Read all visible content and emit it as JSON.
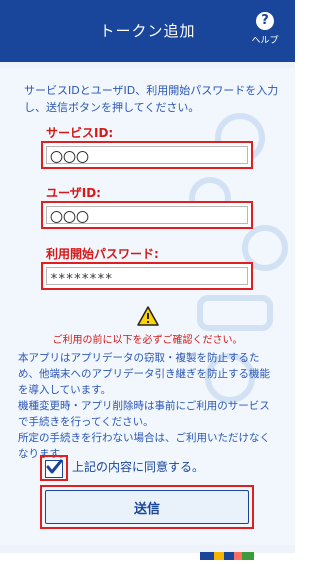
{
  "header": {
    "title": "トークン追加",
    "help_label": "ヘルプ"
  },
  "intro_text": "サービスIDとユーザID、利用開始パスワードを入力し、送信ボタンを押してください。",
  "fields": {
    "service_id": {
      "label": "サービスID:",
      "value": "〇〇〇"
    },
    "user_id": {
      "label": "ユーザID:",
      "value": "〇〇〇"
    },
    "password": {
      "label": "利用開始パスワード:",
      "value": "********"
    }
  },
  "warning_text": "ご利用の前に以下を必ずご確認ください。",
  "notice": {
    "para1": "本アプリはアプリデータの窃取・複製を防止するため、他端末へのアプリデータ引き継ぎを防止する機能を導入しています。",
    "para2": "機種変更時・アプリ削除時は事前にご利用のサービスで手続きを行ってください。",
    "para3": "所定の手続きを行わない場合は、ご利用いただけなくなります。"
  },
  "agree": {
    "label": "上記の内容に同意する。",
    "checked": true
  },
  "send_button": "送信",
  "colors": {
    "header_bg": "#19459a",
    "accent_red": "#e02020",
    "text_blue": "#2b56b7"
  },
  "icons": {
    "help": "question-circle-icon",
    "warning": "warning-triangle-icon",
    "check": "checkmark-icon"
  }
}
